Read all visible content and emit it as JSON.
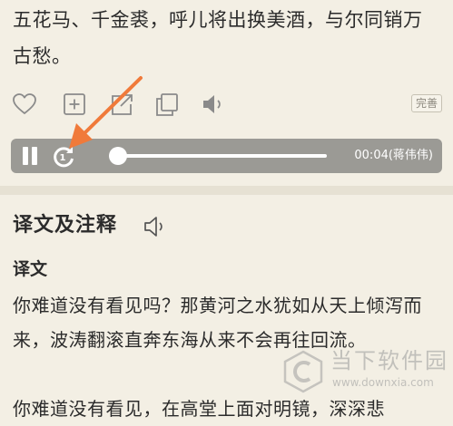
{
  "poem": {
    "line1": "五花马、千金裘，呼儿将出换美酒，与尔同销万",
    "line2": "古愁。"
  },
  "actions": {
    "icons": [
      "heart-icon",
      "add-box-icon",
      "share-icon",
      "copy-icon",
      "speaker-icon"
    ],
    "complete_label": "完善"
  },
  "player": {
    "state": "paused-icon-shown",
    "replay_count": "1",
    "progress": 0.0,
    "time_label": "00:04(蒋伟伟)"
  },
  "section": {
    "title": "译文及注释",
    "subtitle": "译文",
    "translation": "你难道没有看见吗？那黄河之水犹如从天上倾泻而来，波涛翻滚直奔东海从来不会再往回流。",
    "translation_cut": "你难道没有看见，在高堂上面对明镜，深深悲"
  },
  "watermark": {
    "name": "当下软件园",
    "url": "www.downxia.com"
  },
  "colors": {
    "background": "#f3efe4",
    "player": "#9b9a95",
    "arrow": "#f07a3a"
  }
}
